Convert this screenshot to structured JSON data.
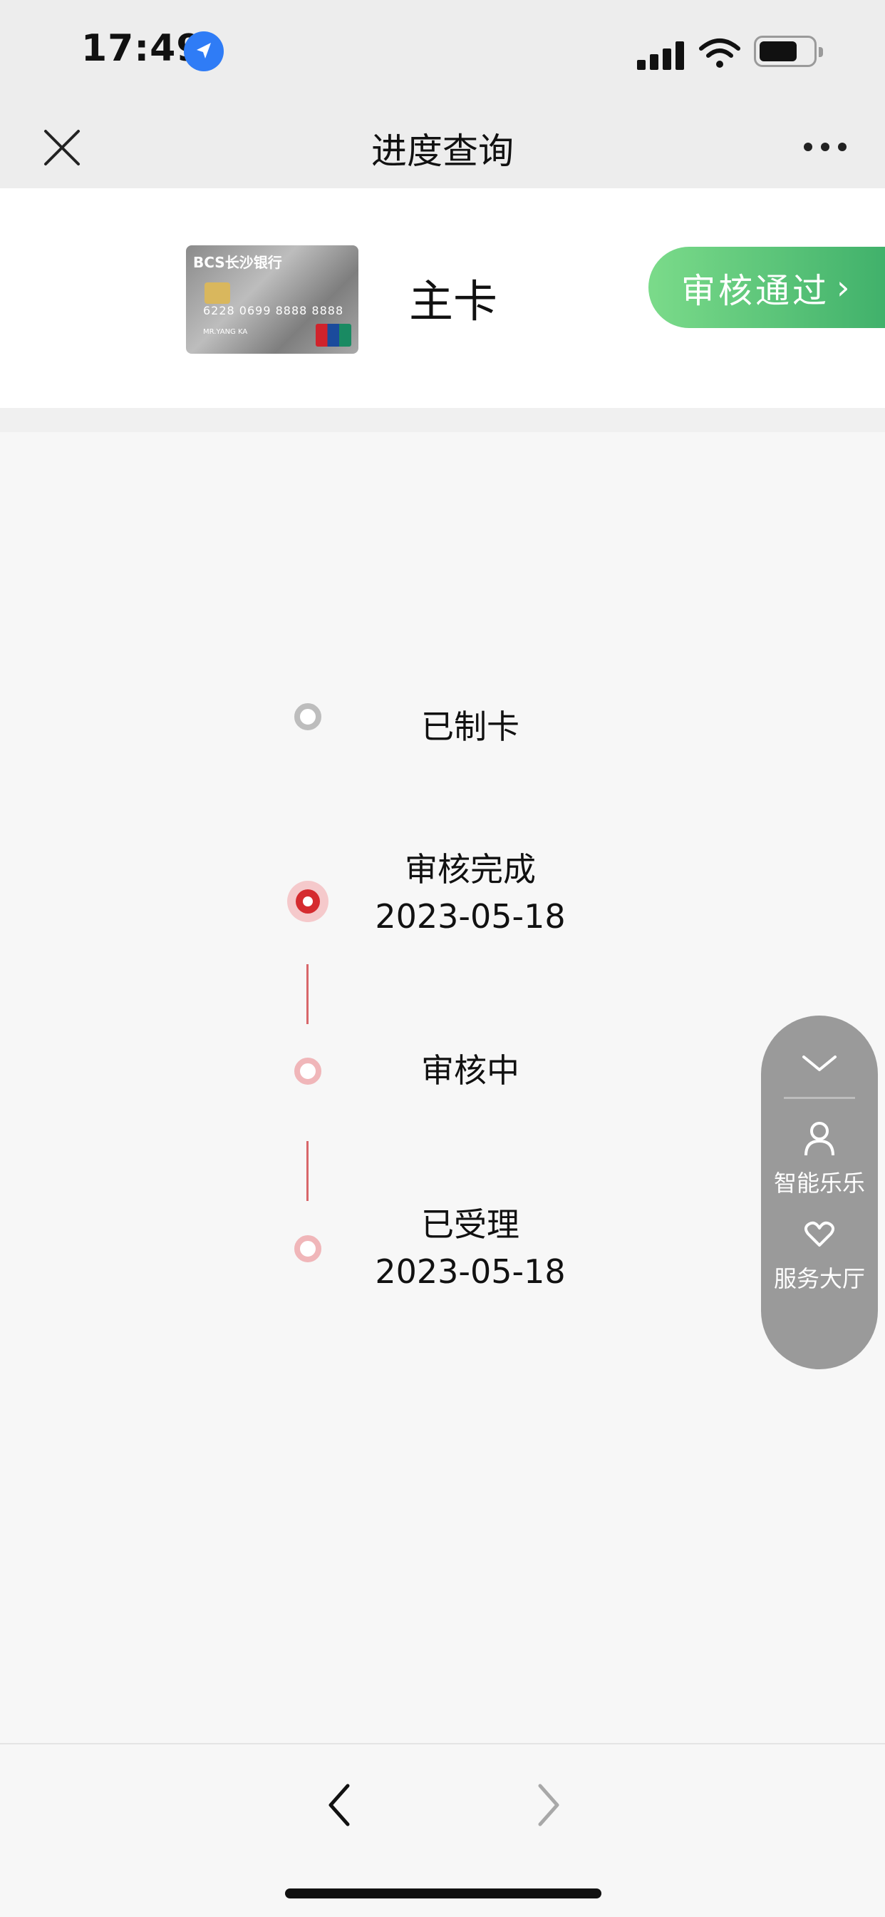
{
  "status_bar": {
    "time": "17:49",
    "location_icon": "location-arrow-icon",
    "signal_icon": "cellular-signal-icon",
    "wifi_icon": "wifi-icon",
    "battery_icon": "battery-icon"
  },
  "nav": {
    "title": "进度查询",
    "close_icon": "close-icon",
    "more_icon": "more-dots-icon"
  },
  "card": {
    "bank_name": "BCS长沙银行",
    "card_number": "6228 0699 8888 8888",
    "holder": "MR.YANG KA",
    "card_type": "主卡",
    "status_label": "审核通过",
    "status_chevron": "›",
    "status_color": "#4fbe73"
  },
  "timeline": {
    "steps": [
      {
        "label": "已制卡",
        "date": ""
      },
      {
        "label": "审核完成",
        "date": "2023-05-18"
      },
      {
        "label": "审核中",
        "date": ""
      },
      {
        "label": "已受理",
        "date": "2023-05-18"
      }
    ],
    "active_color": "#d52b2f"
  },
  "float_menu": {
    "collapse_icon": "chevron-down-icon",
    "items": [
      {
        "label": "智能乐乐",
        "icon": "person-icon"
      },
      {
        "label": "服务大厅",
        "icon": "heart-hands-icon"
      }
    ]
  },
  "bottom_nav": {
    "back_icon": "chevron-left-icon",
    "forward_icon": "chevron-right-icon"
  }
}
